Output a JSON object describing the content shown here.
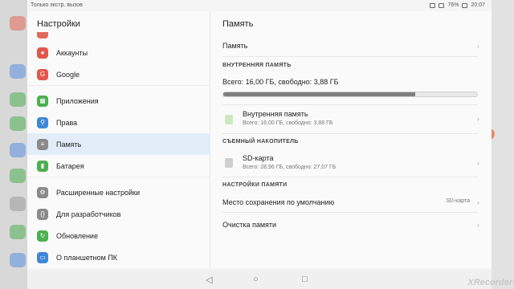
{
  "statusbar": {
    "left_text": "Только экстр. вызов",
    "battery": "76%",
    "time": "20:07"
  },
  "left": {
    "title": "Настройки",
    "items": [
      {
        "label": "Аккаунты",
        "icon": "account-icon",
        "color": "#e2574c"
      },
      {
        "label": "Google",
        "icon": "google-icon",
        "color": "#e2574c"
      },
      {
        "label": "Приложения",
        "icon": "apps-icon",
        "color": "#4caf50"
      },
      {
        "label": "Права",
        "icon": "permissions-icon",
        "color": "#3f87d6"
      },
      {
        "label": "Память",
        "icon": "storage-icon",
        "color": "#8a8a8a"
      },
      {
        "label": "Батарея",
        "icon": "battery-icon",
        "color": "#4caf50"
      },
      {
        "label": "Расширенные настройки",
        "icon": "gear-icon",
        "color": "#8a8a8a"
      },
      {
        "label": "Для разработчиков",
        "icon": "braces-icon",
        "color": "#8a8a8a"
      },
      {
        "label": "Обновление",
        "icon": "update-icon",
        "color": "#4caf50"
      },
      {
        "label": "О планшетном ПК",
        "icon": "tablet-icon",
        "color": "#3f87d6"
      }
    ]
  },
  "right": {
    "title": "Память",
    "memory_row": "Память",
    "internal_section": "ВНУТРЕННЯЯ ПАМЯТЬ",
    "summary": "Всего: 16,00 ГБ, свободно: 3,88 ГБ",
    "used_fraction": 0.7575,
    "internal_item": {
      "title": "Внутренняя память",
      "sub": "Всего: 16,00 ГБ, свободно: 3,88 ГБ"
    },
    "removable_section": "СЪЕМНЫЙ НАКОПИТЕЛЬ",
    "sd_item": {
      "title": "SD-карта",
      "sub": "Всего: 28,96 ГБ, свободно: 27,07 ГБ"
    },
    "settings_section": "НАСТРОЙКИ ПАМЯТИ",
    "default_location": {
      "label": "Место сохранения по умолчанию",
      "value": "SD-карта"
    },
    "cleanup": "Очистка памяти"
  },
  "watermark": "XRecorder"
}
